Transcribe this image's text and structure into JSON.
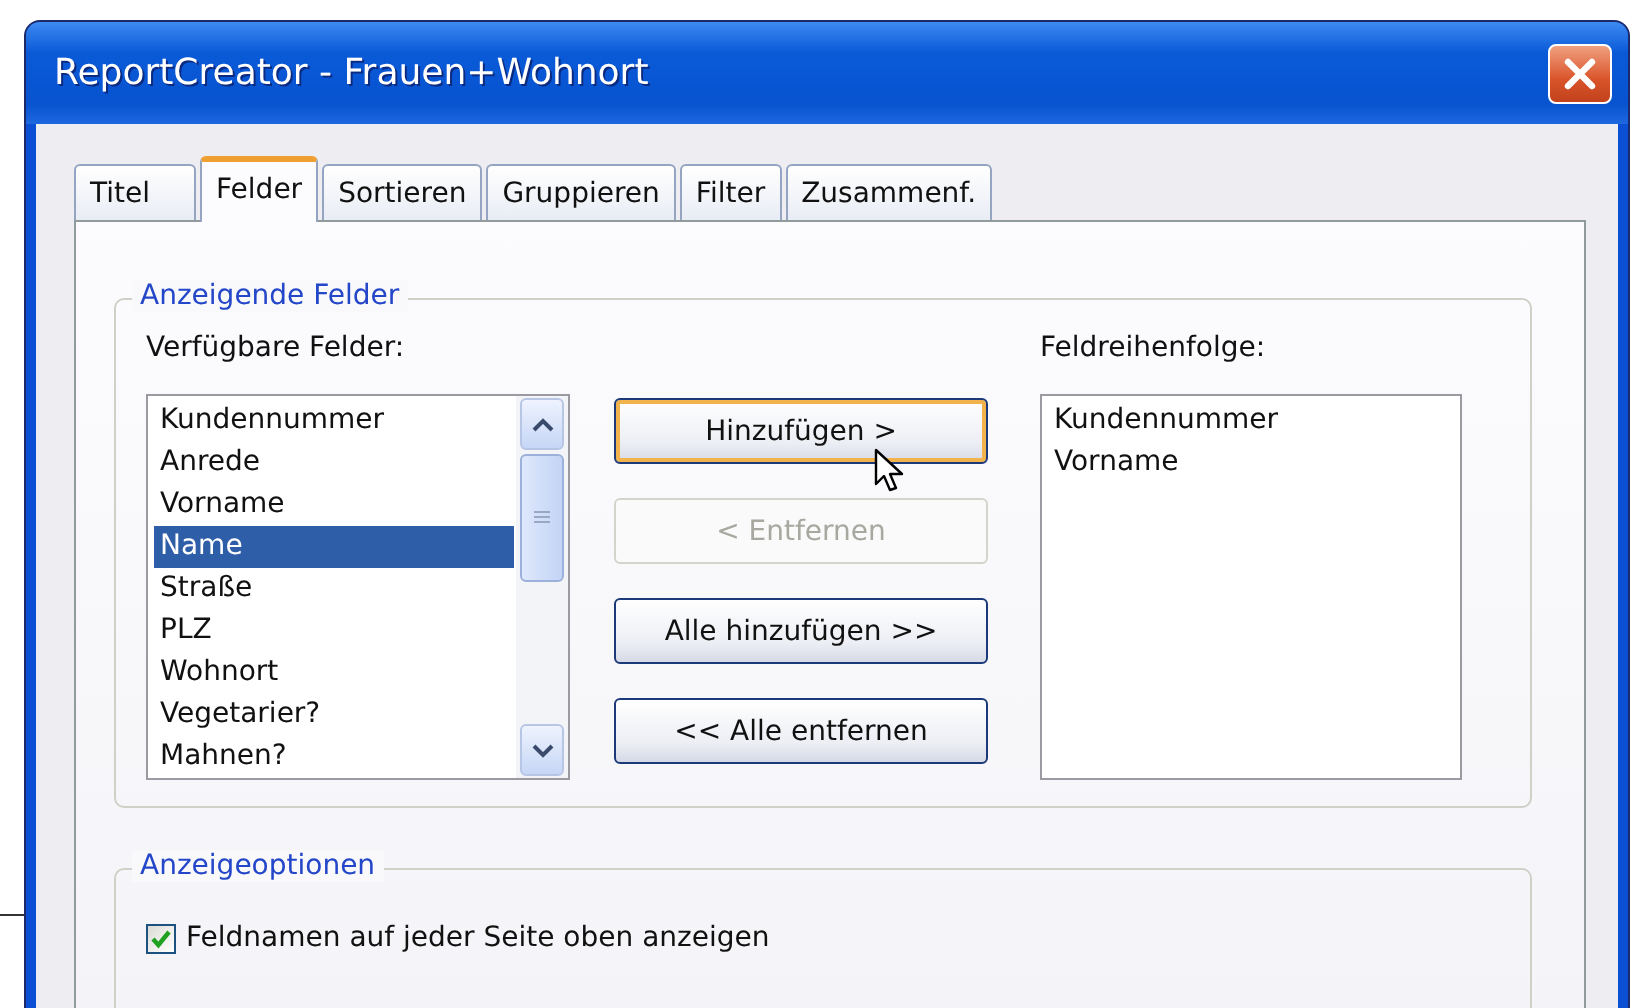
{
  "window": {
    "title": "ReportCreator - Frauen+Wohnort"
  },
  "tabs": [
    {
      "label": "Titel",
      "selected": false
    },
    {
      "label": "Felder",
      "selected": true
    },
    {
      "label": "Sortieren",
      "selected": false
    },
    {
      "label": "Gruppieren",
      "selected": false
    },
    {
      "label": "Filter",
      "selected": false
    },
    {
      "label": "Zusammenf.",
      "selected": false
    }
  ],
  "fields_group": {
    "legend": "Anzeigende Felder",
    "available": {
      "label": "Verfügbare Felder:",
      "items": [
        {
          "label": "Kundennummer",
          "selected": false
        },
        {
          "label": "Anrede",
          "selected": false
        },
        {
          "label": "Vorname",
          "selected": false
        },
        {
          "label": "Name",
          "selected": true
        },
        {
          "label": "Straße",
          "selected": false
        },
        {
          "label": "PLZ",
          "selected": false
        },
        {
          "label": "Wohnort",
          "selected": false
        },
        {
          "label": "Vegetarier?",
          "selected": false
        },
        {
          "label": "Mahnen?",
          "selected": false
        }
      ]
    },
    "buttons": [
      {
        "label": "Hinzufügen >",
        "disabled": false,
        "hot": true
      },
      {
        "label": "< Entfernen",
        "disabled": true,
        "hot": false
      },
      {
        "label": "Alle hinzufügen >>",
        "disabled": false,
        "hot": false
      },
      {
        "label": "<< Alle entfernen",
        "disabled": false,
        "hot": false
      }
    ],
    "order": {
      "label": "Feldreihenfolge:",
      "items": [
        {
          "label": "Kundennummer",
          "selected": false
        },
        {
          "label": "Vorname",
          "selected": false
        }
      ]
    }
  },
  "options_group": {
    "legend": "Anzeigeoptionen",
    "checkboxes": [
      {
        "label": "Feldnamen auf jeder Seite oben anzeigen",
        "checked": true
      }
    ]
  }
}
